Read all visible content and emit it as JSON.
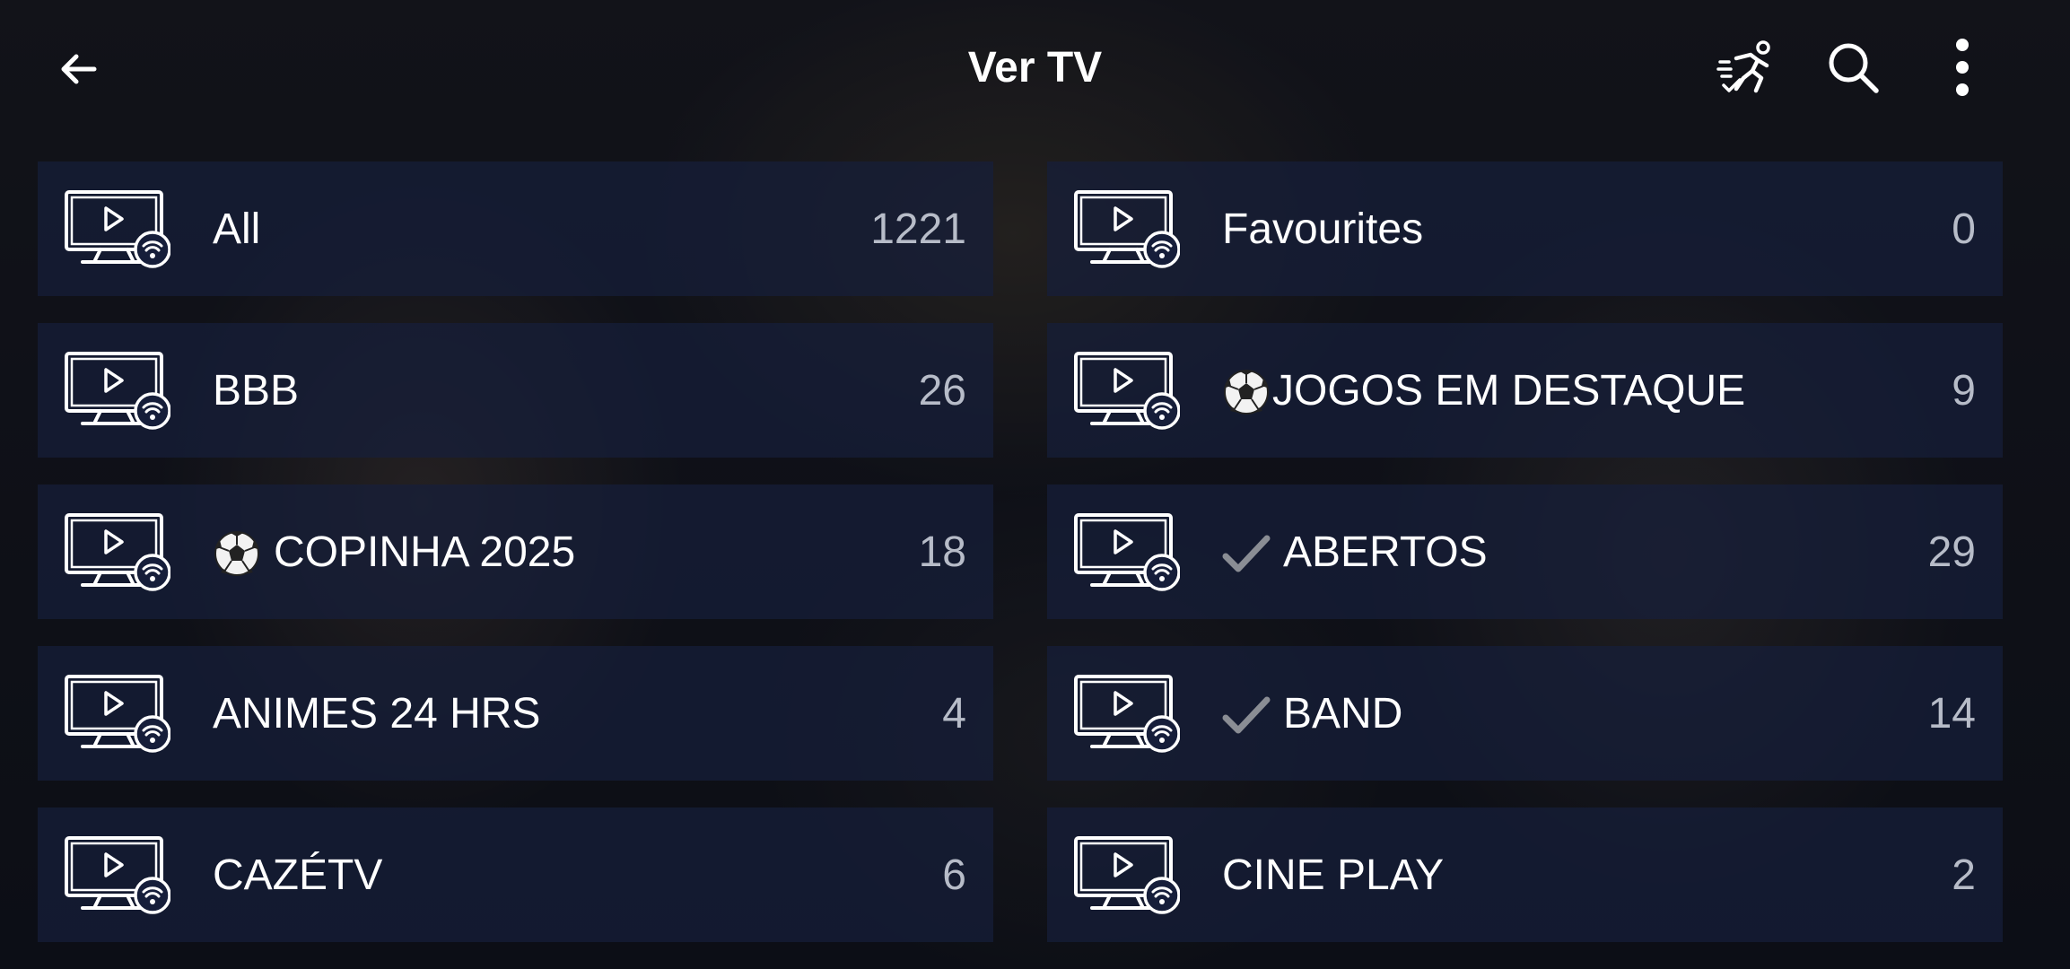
{
  "header": {
    "title": "Ver TV",
    "back_icon": "arrow-left-icon",
    "icons": [
      "running-man-icon",
      "search-icon",
      "more-vert-icon"
    ]
  },
  "colors": {
    "tile_bg": "#161e3a",
    "text": "#ffffff",
    "count": "#b7bcc8"
  },
  "categories": [
    {
      "label": "All",
      "count": "1221",
      "prefix": ""
    },
    {
      "label": "Favourites",
      "count": "0",
      "prefix": ""
    },
    {
      "label": "BBB",
      "count": "26",
      "prefix": ""
    },
    {
      "label": "JOGOS EM DESTAQUE",
      "count": "9",
      "prefix": "soccer-ball-icon"
    },
    {
      "label": "COPINHA 2025",
      "count": "18",
      "prefix": "soccer-ball-icon"
    },
    {
      "label": "ABERTOS",
      "count": "29",
      "prefix": "check-icon"
    },
    {
      "label": "ANIMES 24 HRS",
      "count": "4",
      "prefix": ""
    },
    {
      "label": "BAND",
      "count": "14",
      "prefix": "check-icon"
    },
    {
      "label": "CAZÉTV",
      "count": "6",
      "prefix": ""
    },
    {
      "label": "CINE PLAY",
      "count": "2",
      "prefix": ""
    }
  ]
}
